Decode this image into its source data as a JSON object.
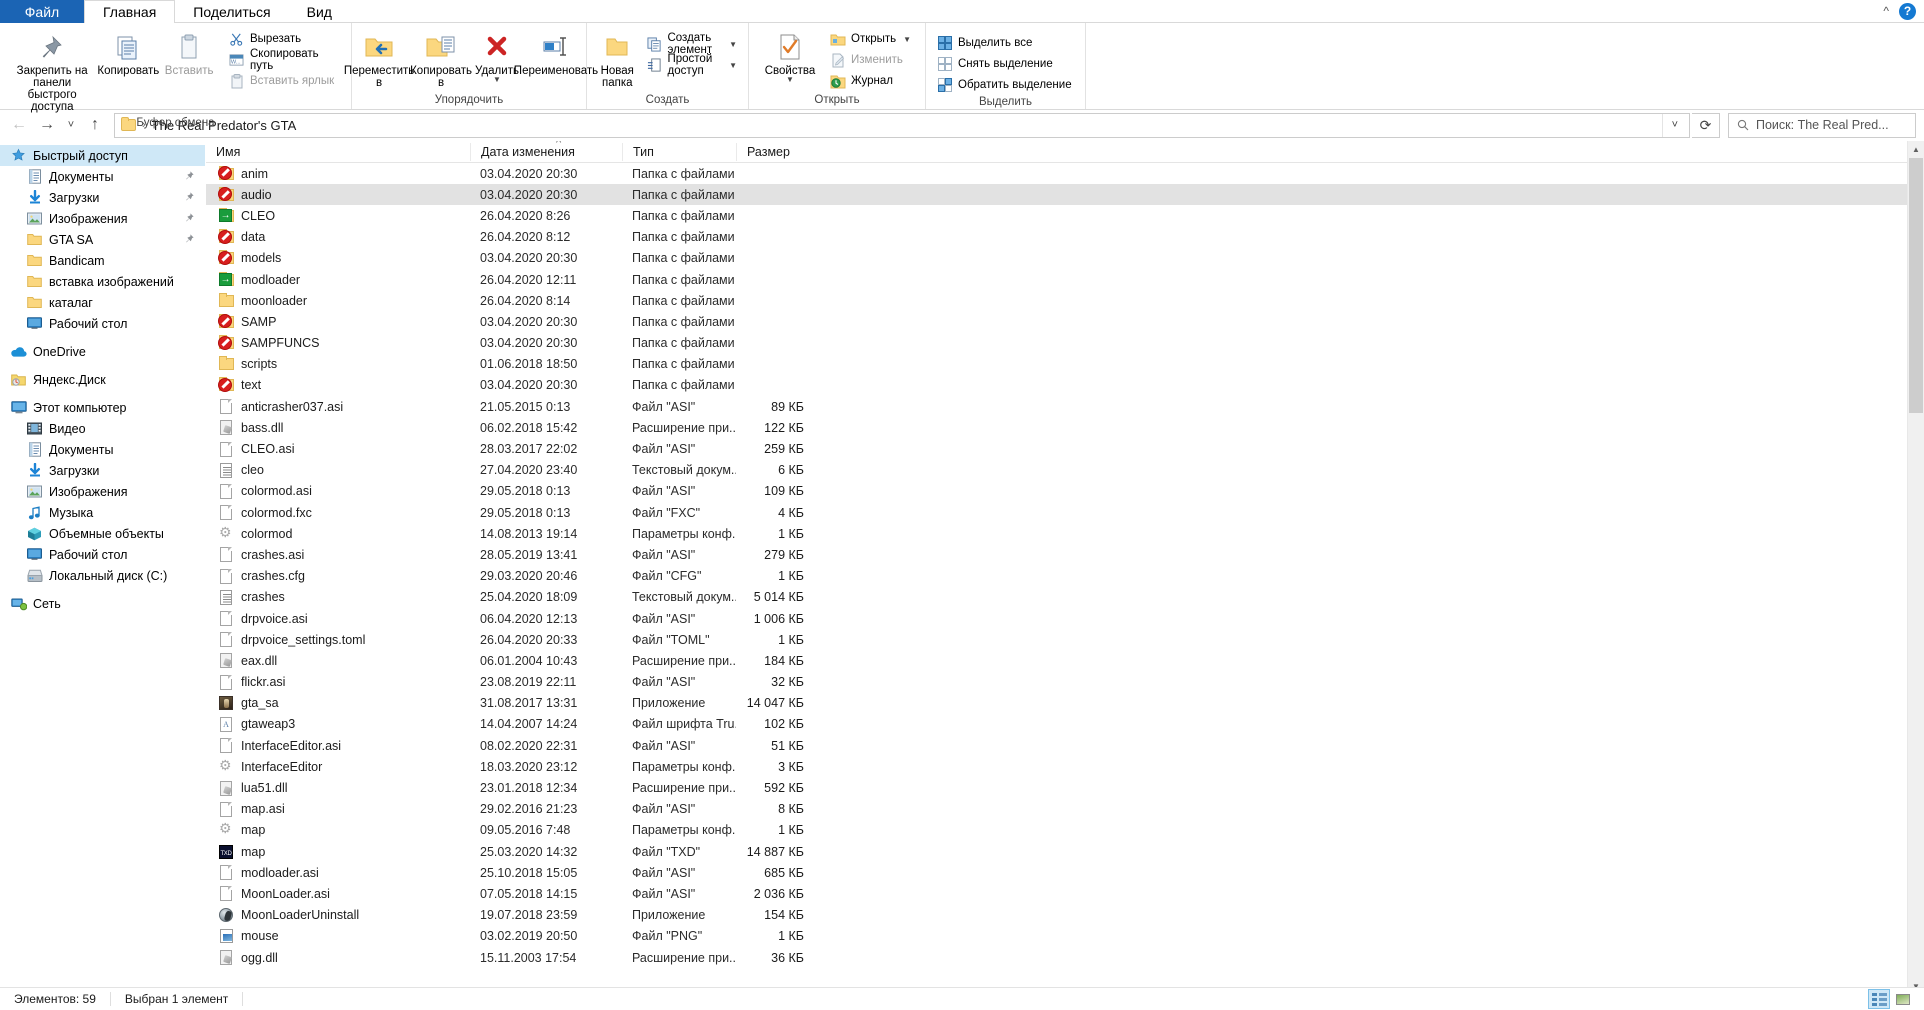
{
  "window": {
    "tabs": [
      {
        "label": "Файл",
        "type": "file"
      },
      {
        "label": "Главная",
        "type": "active"
      },
      {
        "label": "Поделиться",
        "type": "normal"
      },
      {
        "label": "Вид",
        "type": "normal"
      }
    ],
    "collapse_icon": "chevron-up-icon",
    "help_icon": "?"
  },
  "ribbon": {
    "groups": [
      {
        "title": "Буфер обмена",
        "big": [
          {
            "label": "Закрепить на панели\nбыстрого доступа",
            "icon": "pin-icon",
            "disabled": false
          },
          {
            "label": "Копировать",
            "icon": "copy-icon",
            "disabled": false
          },
          {
            "label": "Вставить",
            "icon": "paste-icon",
            "disabled": true
          }
        ],
        "small": [
          {
            "label": "Вырезать",
            "icon": "scissors-icon",
            "disabled": false
          },
          {
            "label": "Скопировать путь",
            "icon": "copy-path-icon",
            "disabled": false
          },
          {
            "label": "Вставить ярлык",
            "icon": "paste-shortcut-icon",
            "disabled": true
          }
        ]
      },
      {
        "title": "Упорядочить",
        "big": [
          {
            "label": "Переместить\nв",
            "icon": "move-to-icon",
            "dropdown": true
          },
          {
            "label": "Копировать\nв",
            "icon": "copy-to-icon",
            "dropdown": true
          },
          {
            "label": "Удалить",
            "icon": "delete-icon",
            "dropdown": true
          },
          {
            "label": "Переименовать",
            "icon": "rename-icon",
            "dropdown": false
          }
        ],
        "small": []
      },
      {
        "title": "Создать",
        "big": [
          {
            "label": "Новая\nпапка",
            "icon": "new-folder-icon",
            "dropdown": false
          }
        ],
        "small": [
          {
            "label": "Создать элемент",
            "icon": "new-item-icon",
            "dropdown": true
          },
          {
            "label": "Простой доступ",
            "icon": "easy-access-icon",
            "dropdown": true
          }
        ]
      },
      {
        "title": "Открыть",
        "big": [
          {
            "label": "Свойства",
            "icon": "properties-icon",
            "dropdown": true
          }
        ],
        "small": [
          {
            "label": "Открыть",
            "icon": "open-icon",
            "dropdown": true,
            "disabled": false
          },
          {
            "label": "Изменить",
            "icon": "edit-icon",
            "disabled": true
          },
          {
            "label": "Журнал",
            "icon": "history-icon",
            "disabled": false
          }
        ]
      },
      {
        "title": "Выделить",
        "big": [],
        "small": [
          {
            "label": "Выделить все",
            "icon": "select-all-icon"
          },
          {
            "label": "Снять выделение",
            "icon": "select-none-icon"
          },
          {
            "label": "Обратить выделение",
            "icon": "invert-selection-icon"
          }
        ]
      }
    ]
  },
  "addressbar": {
    "back_icon": "arrow-left-icon",
    "forward_icon": "arrow-right-icon",
    "recent_icon": "chevron-down-icon",
    "up_icon": "arrow-up-icon",
    "folder_icon": "folder-icon",
    "path": "The Real Predator's GTA",
    "path_separator": "›",
    "dropdown_icon": "chevron-down-icon",
    "refresh_icon": "refresh-icon",
    "search_icon": "search-icon",
    "search_placeholder": "Поиск: The Real Pred..."
  },
  "navpane": {
    "items": [
      {
        "label": "Быстрый доступ",
        "icon": "star-pin-icon",
        "indent": 0,
        "selected": true,
        "pinned": false
      },
      {
        "label": "Документы",
        "icon": "documents-icon",
        "indent": 1,
        "pinned": true
      },
      {
        "label": "Загрузки",
        "icon": "downloads-icon",
        "indent": 1,
        "pinned": true
      },
      {
        "label": "Изображения",
        "icon": "pictures-icon",
        "indent": 1,
        "pinned": true
      },
      {
        "label": "GTA SA",
        "icon": "folder-icon",
        "indent": 1,
        "pinned": true
      },
      {
        "label": "Bandicam",
        "icon": "folder-icon",
        "indent": 1,
        "pinned": false
      },
      {
        "label": "вставка изображений",
        "icon": "folder-icon",
        "indent": 1,
        "pinned": false
      },
      {
        "label": "каталаг",
        "icon": "folder-icon",
        "indent": 1,
        "pinned": false
      },
      {
        "label": "Рабочий стол",
        "icon": "desktop-icon",
        "indent": 1,
        "pinned": false
      },
      {
        "gap": true
      },
      {
        "label": "OneDrive",
        "icon": "onedrive-icon",
        "indent": 0
      },
      {
        "gap": true
      },
      {
        "label": "Яндекс.Диск",
        "icon": "yandex-disk-icon",
        "indent": 0
      },
      {
        "gap": true
      },
      {
        "label": "Этот компьютер",
        "icon": "this-pc-icon",
        "indent": 0
      },
      {
        "label": "Видео",
        "icon": "videos-icon",
        "indent": 1
      },
      {
        "label": "Документы",
        "icon": "documents-icon",
        "indent": 1
      },
      {
        "label": "Загрузки",
        "icon": "downloads-icon",
        "indent": 1
      },
      {
        "label": "Изображения",
        "icon": "pictures-icon",
        "indent": 1
      },
      {
        "label": "Музыка",
        "icon": "music-icon",
        "indent": 1
      },
      {
        "label": "Объемные объекты",
        "icon": "3d-objects-icon",
        "indent": 1
      },
      {
        "label": "Рабочий стол",
        "icon": "desktop-icon",
        "indent": 1
      },
      {
        "label": "Локальный диск (C:)",
        "icon": "drive-icon",
        "indent": 1
      },
      {
        "gap": true
      },
      {
        "label": "Сеть",
        "icon": "network-icon",
        "indent": 0
      }
    ]
  },
  "filelist": {
    "columns": [
      {
        "key": "name",
        "label": "Имя",
        "sorted": true
      },
      {
        "key": "date",
        "label": "Дата изменения"
      },
      {
        "key": "type",
        "label": "Тип"
      },
      {
        "key": "size",
        "label": "Размер"
      }
    ],
    "sort_indicator": "ascending-caret",
    "rows": [
      {
        "name": "anim",
        "date": "03.04.2020 20:30",
        "type": "Папка с файлами",
        "size": "",
        "icon": "folder-blocked-icon",
        "selected": false
      },
      {
        "name": "audio",
        "date": "03.04.2020 20:30",
        "type": "Папка с файлами",
        "size": "",
        "icon": "folder-blocked-icon",
        "selected": true
      },
      {
        "name": "CLEO",
        "date": "26.04.2020 8:26",
        "type": "Папка с файлами",
        "size": "",
        "icon": "folder-shortcut-icon",
        "selected": false
      },
      {
        "name": "data",
        "date": "26.04.2020 8:12",
        "type": "Папка с файлами",
        "size": "",
        "icon": "folder-blocked-icon",
        "selected": false
      },
      {
        "name": "models",
        "date": "03.04.2020 20:30",
        "type": "Папка с файлами",
        "size": "",
        "icon": "folder-blocked-icon",
        "selected": false
      },
      {
        "name": "modloader",
        "date": "26.04.2020 12:11",
        "type": "Папка с файлами",
        "size": "",
        "icon": "folder-shortcut-icon",
        "selected": false
      },
      {
        "name": "moonloader",
        "date": "26.04.2020 8:14",
        "type": "Папка с файлами",
        "size": "",
        "icon": "folder-icon",
        "selected": false
      },
      {
        "name": "SAMP",
        "date": "03.04.2020 20:30",
        "type": "Папка с файлами",
        "size": "",
        "icon": "folder-blocked-icon",
        "selected": false
      },
      {
        "name": "SAMPFUNCS",
        "date": "03.04.2020 20:30",
        "type": "Папка с файлами",
        "size": "",
        "icon": "folder-blocked-icon",
        "selected": false
      },
      {
        "name": "scripts",
        "date": "01.06.2018 18:50",
        "type": "Папка с файлами",
        "size": "",
        "icon": "folder-icon",
        "selected": false
      },
      {
        "name": "text",
        "date": "03.04.2020 20:30",
        "type": "Папка с файлами",
        "size": "",
        "icon": "folder-blocked-icon",
        "selected": false
      },
      {
        "name": "anticrasher037.asi",
        "date": "21.05.2015 0:13",
        "type": "Файл \"ASI\"",
        "size": "89 КБ",
        "icon": "generic-file-icon",
        "selected": false
      },
      {
        "name": "bass.dll",
        "date": "06.02.2018 15:42",
        "type": "Расширение при...",
        "size": "122 КБ",
        "icon": "dll-file-icon",
        "selected": false
      },
      {
        "name": "CLEO.asi",
        "date": "28.03.2017 22:02",
        "type": "Файл \"ASI\"",
        "size": "259 КБ",
        "icon": "generic-file-icon",
        "selected": false
      },
      {
        "name": "cleo",
        "date": "27.04.2020 23:40",
        "type": "Текстовый докум...",
        "size": "6 КБ",
        "icon": "text-file-icon",
        "selected": false
      },
      {
        "name": "colormod.asi",
        "date": "29.05.2018 0:13",
        "type": "Файл \"ASI\"",
        "size": "109 КБ",
        "icon": "generic-file-icon",
        "selected": false
      },
      {
        "name": "colormod.fxc",
        "date": "29.05.2018 0:13",
        "type": "Файл \"FXC\"",
        "size": "4 КБ",
        "icon": "generic-file-icon",
        "selected": false
      },
      {
        "name": "colormod",
        "date": "14.08.2013 19:14",
        "type": "Параметры конф...",
        "size": "1 КБ",
        "icon": "config-file-icon",
        "selected": false
      },
      {
        "name": "crashes.asi",
        "date": "28.05.2019 13:41",
        "type": "Файл \"ASI\"",
        "size": "279 КБ",
        "icon": "generic-file-icon",
        "selected": false
      },
      {
        "name": "crashes.cfg",
        "date": "29.03.2020 20:46",
        "type": "Файл \"CFG\"",
        "size": "1 КБ",
        "icon": "generic-file-icon",
        "selected": false
      },
      {
        "name": "crashes",
        "date": "25.04.2020 18:09",
        "type": "Текстовый докум...",
        "size": "5 014 КБ",
        "icon": "text-file-icon",
        "selected": false
      },
      {
        "name": "drpvoice.asi",
        "date": "06.04.2020 12:13",
        "type": "Файл \"ASI\"",
        "size": "1 006 КБ",
        "icon": "generic-file-icon",
        "selected": false
      },
      {
        "name": "drpvoice_settings.toml",
        "date": "26.04.2020 20:33",
        "type": "Файл \"TOML\"",
        "size": "1 КБ",
        "icon": "generic-file-icon",
        "selected": false
      },
      {
        "name": "eax.dll",
        "date": "06.01.2004 10:43",
        "type": "Расширение при...",
        "size": "184 КБ",
        "icon": "dll-file-icon",
        "selected": false
      },
      {
        "name": "flickr.asi",
        "date": "23.08.2019 22:11",
        "type": "Файл \"ASI\"",
        "size": "32 КБ",
        "icon": "generic-file-icon",
        "selected": false
      },
      {
        "name": "gta_sa",
        "date": "31.08.2017 13:31",
        "type": "Приложение",
        "size": "14 047 КБ",
        "icon": "exe-file-icon",
        "selected": false
      },
      {
        "name": "gtaweap3",
        "date": "14.04.2007 14:24",
        "type": "Файл шрифта Tru...",
        "size": "102 КБ",
        "icon": "font-file-icon",
        "selected": false
      },
      {
        "name": "InterfaceEditor.asi",
        "date": "08.02.2020 22:31",
        "type": "Файл \"ASI\"",
        "size": "51 КБ",
        "icon": "generic-file-icon",
        "selected": false
      },
      {
        "name": "InterfaceEditor",
        "date": "18.03.2020 23:12",
        "type": "Параметры конф...",
        "size": "3 КБ",
        "icon": "config-file-icon",
        "selected": false
      },
      {
        "name": "lua51.dll",
        "date": "23.01.2018 12:34",
        "type": "Расширение при...",
        "size": "592 КБ",
        "icon": "dll-file-icon",
        "selected": false
      },
      {
        "name": "map.asi",
        "date": "29.02.2016 21:23",
        "type": "Файл \"ASI\"",
        "size": "8 КБ",
        "icon": "generic-file-icon",
        "selected": false
      },
      {
        "name": "map",
        "date": "09.05.2016 7:48",
        "type": "Параметры конф...",
        "size": "1 КБ",
        "icon": "config-file-icon",
        "selected": false
      },
      {
        "name": "map",
        "date": "25.03.2020 14:32",
        "type": "Файл \"TXD\"",
        "size": "14 887 КБ",
        "icon": "txd-file-icon",
        "selected": false
      },
      {
        "name": "modloader.asi",
        "date": "25.10.2018 15:05",
        "type": "Файл \"ASI\"",
        "size": "685 КБ",
        "icon": "generic-file-icon",
        "selected": false
      },
      {
        "name": "MoonLoader.asi",
        "date": "07.05.2018 14:15",
        "type": "Файл \"ASI\"",
        "size": "2 036 КБ",
        "icon": "generic-file-icon",
        "selected": false
      },
      {
        "name": "MoonLoaderUninstall",
        "date": "19.07.2018 23:59",
        "type": "Приложение",
        "size": "154 КБ",
        "icon": "moonloader-uninstall-icon",
        "selected": false
      },
      {
        "name": "mouse",
        "date": "03.02.2019 20:50",
        "type": "Файл \"PNG\"",
        "size": "1 КБ",
        "icon": "png-file-icon",
        "selected": false
      },
      {
        "name": "ogg.dll",
        "date": "15.11.2003 17:54",
        "type": "Расширение при...",
        "size": "36 КБ",
        "icon": "dll-file-icon",
        "selected": false
      }
    ]
  },
  "statusbar": {
    "item_count": "Элементов: 59",
    "selection": "Выбран 1 элемент",
    "details_view_icon": "details-view-icon",
    "thumbnail_view_icon": "thumbnail-view-icon"
  }
}
